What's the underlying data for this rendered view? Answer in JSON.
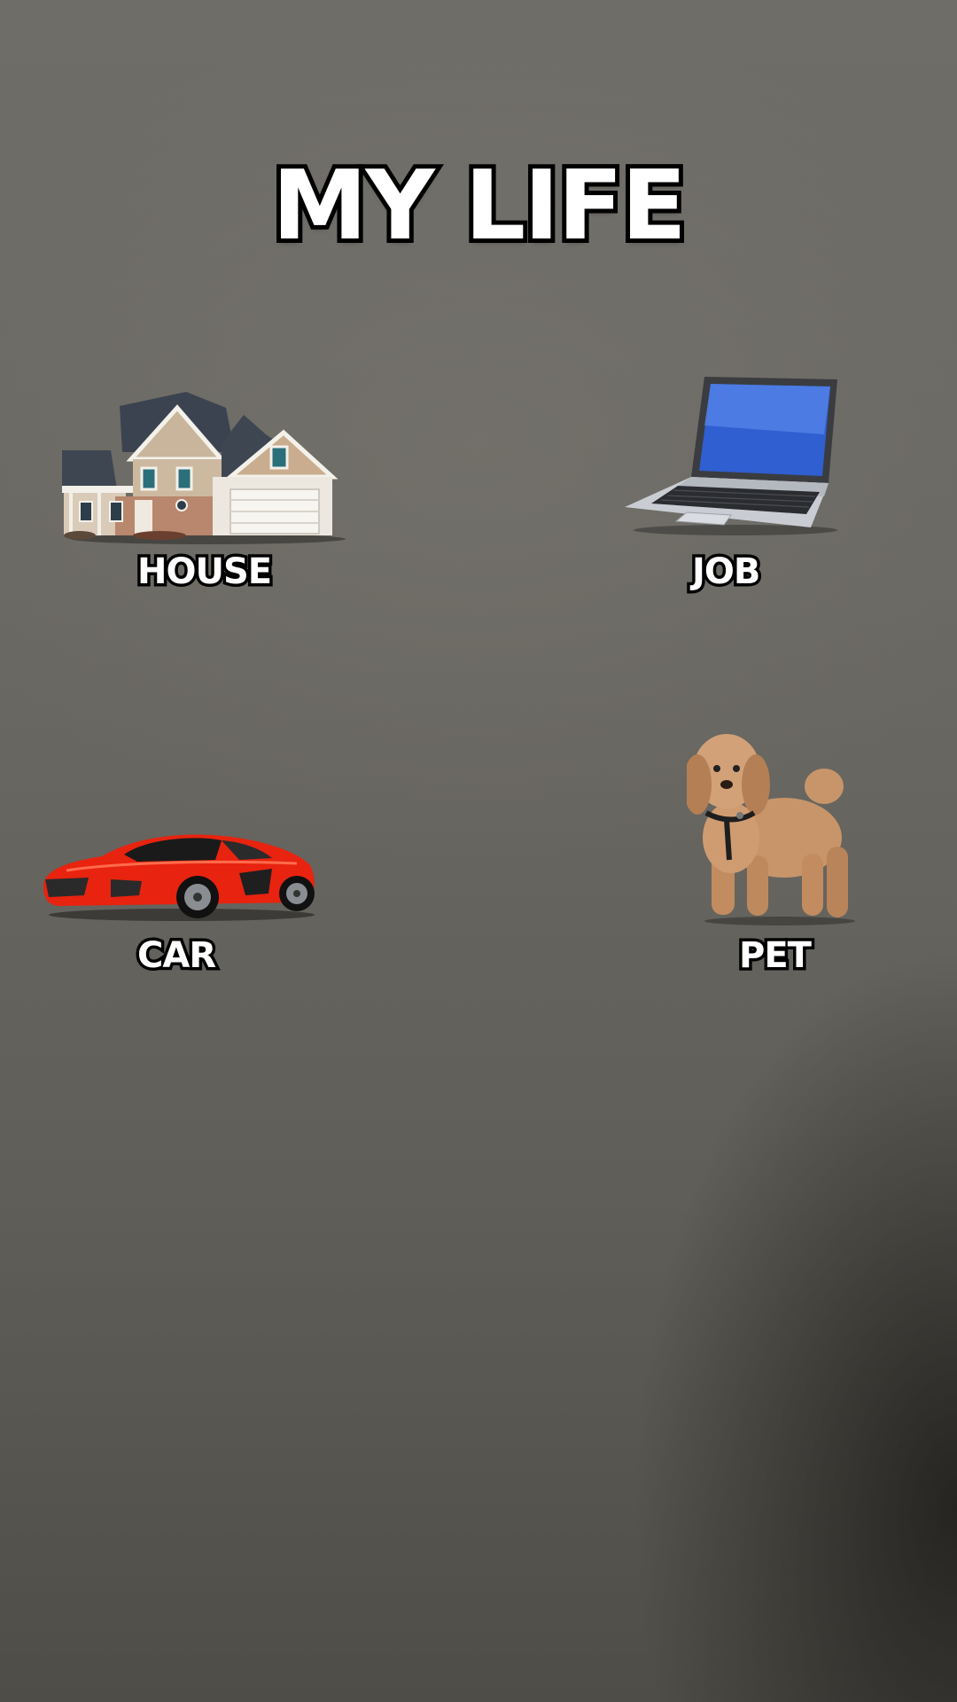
{
  "title": "MY LIFE",
  "items": [
    {
      "label": "HOUSE",
      "icon": "house-icon"
    },
    {
      "label": "JOB",
      "icon": "laptop-icon"
    },
    {
      "label": "CAR",
      "icon": "sports-car-icon"
    },
    {
      "label": "PET",
      "icon": "dog-icon"
    }
  ],
  "colors": {
    "background": "#6b6963",
    "text": "#ffffff",
    "outline": "#000000",
    "car": "#e8230f",
    "dog": "#c8956a",
    "laptop_screen": "#2f5fd0"
  }
}
